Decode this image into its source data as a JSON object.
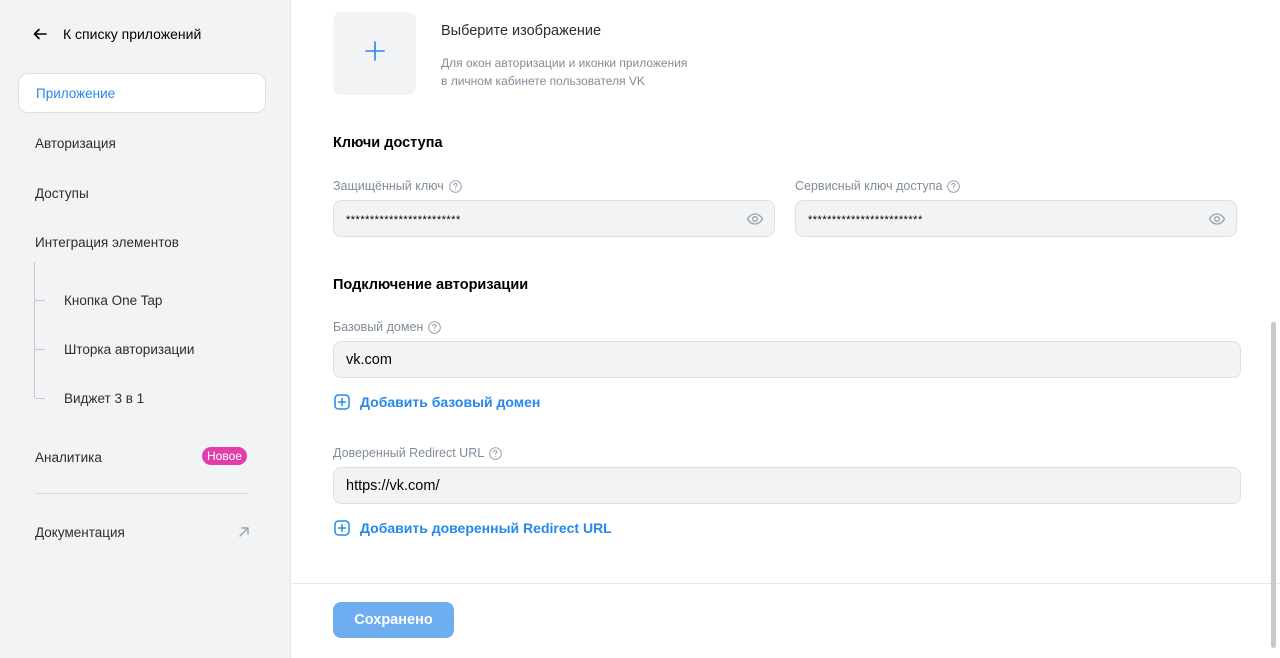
{
  "sidebar": {
    "back_label": "К списку приложений",
    "items": [
      {
        "label": "Приложение",
        "active": true
      },
      {
        "label": "Авторизация"
      },
      {
        "label": "Доступы"
      },
      {
        "label": "Интеграция элементов"
      }
    ],
    "sub_items": [
      {
        "label": "Кнопка One Tap"
      },
      {
        "label": "Шторка авторизации"
      },
      {
        "label": "Виджет 3 в 1"
      }
    ],
    "analytics": {
      "label": "Аналитика",
      "badge": "Новое"
    },
    "docs": {
      "label": "Документация"
    }
  },
  "image_upload": {
    "title": "Выберите изображение",
    "description_line1": "Для окон авторизации и иконки приложения",
    "description_line2": "в личном кабинете пользователя VK"
  },
  "keys": {
    "title": "Ключи доступа",
    "protected_key": {
      "label": "Защищённый ключ",
      "value": "************************"
    },
    "service_key": {
      "label": "Сервисный ключ доступа",
      "value": "************************"
    }
  },
  "auth": {
    "title": "Подключение авторизации",
    "base_domain": {
      "label": "Базовый домен",
      "value": "vk.com"
    },
    "add_base_domain": "Добавить базовый домен",
    "redirect": {
      "label": "Доверенный Redirect URL",
      "value": "https://vk.com/"
    },
    "add_redirect": "Добавить доверенный Redirect URL"
  },
  "footer": {
    "save_label": "Сохранено"
  },
  "colors": {
    "accent": "#2688eb",
    "badge": "#e03fab",
    "save_button": "#6eaef0"
  }
}
